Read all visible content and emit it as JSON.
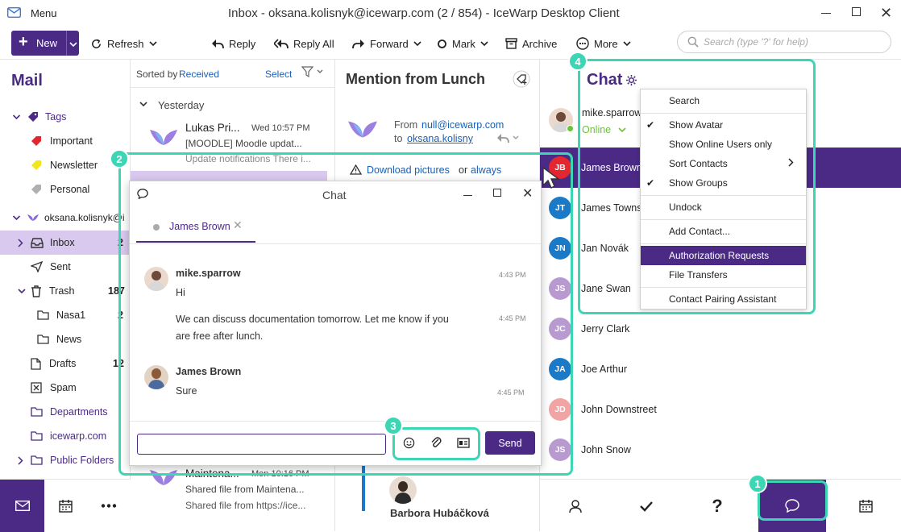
{
  "window": {
    "menu_label": "Menu",
    "title": "Inbox - oksana.kolisnyk@icewarp.com (2 / 854) - IceWarp Desktop Client"
  },
  "toolbar": {
    "new": "New",
    "refresh": "Refresh",
    "reply": "Reply",
    "reply_all": "Reply All",
    "forward": "Forward",
    "mark": "Mark",
    "archive": "Archive",
    "more": "More",
    "search_placeholder": "Search (type '?' for help)"
  },
  "sidebar": {
    "heading": "Mail",
    "tags": "Tags",
    "tag_items": [
      {
        "label": "Important",
        "color": "#e0262e"
      },
      {
        "label": "Newsletter",
        "color": "#f2e61a"
      },
      {
        "label": "Personal",
        "color": "#b0b0b0"
      }
    ],
    "account": "oksana.kolisnyk@i",
    "folders": [
      {
        "label": "Inbox",
        "count": "2"
      },
      {
        "label": "Sent",
        "count": ""
      },
      {
        "label": "Trash",
        "count": "187"
      },
      {
        "label": "Nasa1",
        "count": "2"
      },
      {
        "label": "News",
        "count": ""
      },
      {
        "label": "Drafts",
        "count": "12"
      },
      {
        "label": "Spam",
        "count": ""
      },
      {
        "label": "Departments",
        "count": ""
      },
      {
        "label": "icewarp.com",
        "count": ""
      },
      {
        "label": "Public Folders",
        "count": ""
      }
    ]
  },
  "list": {
    "sorted_by": "Sorted by",
    "sort_field": "Received",
    "select": "Select",
    "group": "Yesterday",
    "msg1": {
      "sender": "Lukas Pri...",
      "time": "Wed 10:57 PM",
      "subject": "[MOODLE] Moodle updat...",
      "preview": "Update notifications There i..."
    },
    "msg2": {
      "sender": "Maintena...",
      "time": "Mon 10:16 PM",
      "subject": "Shared file from Maintena...",
      "preview": "Shared file from https://ice..."
    }
  },
  "reading": {
    "subject": "Mention from Lunch",
    "from_label": "From",
    "from": "null@icewarp.com",
    "to_label": "to",
    "to": "oksana.kolisny",
    "download": "Download pictures",
    "or": "or",
    "always": "always",
    "bottom_sender": "Barbora Hubáčková"
  },
  "chat": {
    "title": "Chat",
    "me": "mike.sparrow",
    "status": "Online",
    "contacts": [
      {
        "initials": "JB",
        "name": "James Brown",
        "color": "#e3262f"
      },
      {
        "initials": "JT",
        "name": "James Townse",
        "color": "#1b7ac8"
      },
      {
        "initials": "JN",
        "name": "Jan Novák",
        "color": "#1b7ac8"
      },
      {
        "initials": "JS",
        "name": "Jane Swan",
        "color": "#b99ad0"
      },
      {
        "initials": "JC",
        "name": "Jerry Clark",
        "color": "#b99ad0"
      },
      {
        "initials": "JA",
        "name": "Joe Arthur",
        "color": "#1b7ac8"
      },
      {
        "initials": "JD",
        "name": "John Downstreet",
        "color": "#f2a3a3"
      },
      {
        "initials": "JS",
        "name": "John Snow",
        "color": "#b99ad0"
      }
    ],
    "menu": {
      "search": "Search",
      "show_avatar": "Show Avatar",
      "show_online": "Show Online Users only",
      "sort_contacts": "Sort Contacts",
      "show_groups": "Show Groups",
      "undock": "Undock",
      "add_contact": "Add Contact...",
      "auth_requests": "Authorization Requests",
      "file_transfers": "File Transfers",
      "pairing": "Contact Pairing Assistant"
    }
  },
  "chatwin": {
    "title": "Chat",
    "tab": "James Brown",
    "send": "Send",
    "messages": [
      {
        "author": "mike.sparrow",
        "time": "4:43 PM",
        "text": "Hi"
      },
      {
        "author": "",
        "time": "4:45 PM",
        "text": "We can discuss documentation tomorrow. Let me know if you are free after lunch."
      },
      {
        "author": "James Brown",
        "time": "4:45 PM",
        "text": "Sure"
      }
    ]
  },
  "badges": [
    "1",
    "2",
    "3",
    "4"
  ],
  "colors": {
    "accent": "#4a2a85",
    "highlight": "#3dd6b5",
    "selection": "#d9c9ee"
  }
}
